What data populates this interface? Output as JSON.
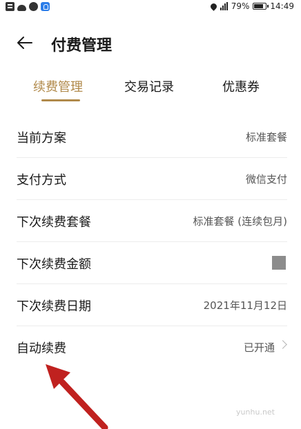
{
  "status_bar": {
    "battery": "79%",
    "battery_level": 0.79,
    "time": "14:49",
    "icons": [
      "notification-icon",
      "cloud-icon",
      "globe-icon",
      "app-icon",
      "location-icon",
      "signal-icon",
      "battery-icon"
    ]
  },
  "header": {
    "title": "付费管理",
    "back_icon": "arrow-left-icon"
  },
  "tabs": [
    {
      "label": "续费管理",
      "active": true
    },
    {
      "label": "交易记录",
      "active": false
    },
    {
      "label": "优惠券",
      "active": false
    }
  ],
  "rows": [
    {
      "label": "当前方案",
      "value": "标准套餐"
    },
    {
      "label": "支付方式",
      "value": "微信支付"
    },
    {
      "label": "下次续费套餐",
      "value": "标准套餐 (连续包月)"
    },
    {
      "label": "下次续费金额",
      "value": ""
    },
    {
      "label": "下次续费日期",
      "value": "2021年11月12日"
    },
    {
      "label": "自动续费",
      "value": "已开通"
    }
  ],
  "watermark": "yunhu.net",
  "colors": {
    "accent": "#b0894a",
    "arrow": "#c0211f",
    "divider": "#ececec"
  }
}
